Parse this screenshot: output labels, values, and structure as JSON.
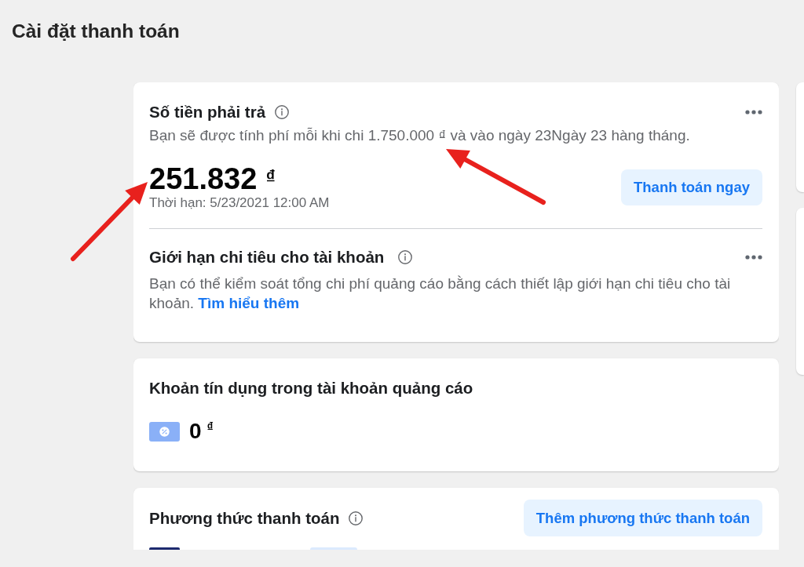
{
  "page": {
    "title": "Cài đặt thanh toán"
  },
  "amount_due": {
    "title": "Số tiền phải trả",
    "description": "Bạn sẽ được tính phí mỗi khi chi 1.750.000 ₫ và vào ngày 23Ngày 23 hàng tháng.",
    "amount": "251.832",
    "currency": "₫",
    "due": "Thời hạn: 5/23/2021 12:00 AM",
    "button": "Thanh toán ngay"
  },
  "spending_limit": {
    "title": "Giới hạn chi tiêu cho tài khoản",
    "description": "Bạn có thể kiểm soát tổng chi phí quảng cáo bằng cách thiết lập giới hạn chi tiêu cho tài khoản.",
    "link": "Tìm hiểu thêm"
  },
  "ad_credit": {
    "title": "Khoản tín dụng trong tài khoản quảng cáo",
    "amount": "0",
    "currency": "₫"
  },
  "payment_methods": {
    "title": "Phương thức thanh toán",
    "button": "Thêm phương thức thanh toán"
  }
}
